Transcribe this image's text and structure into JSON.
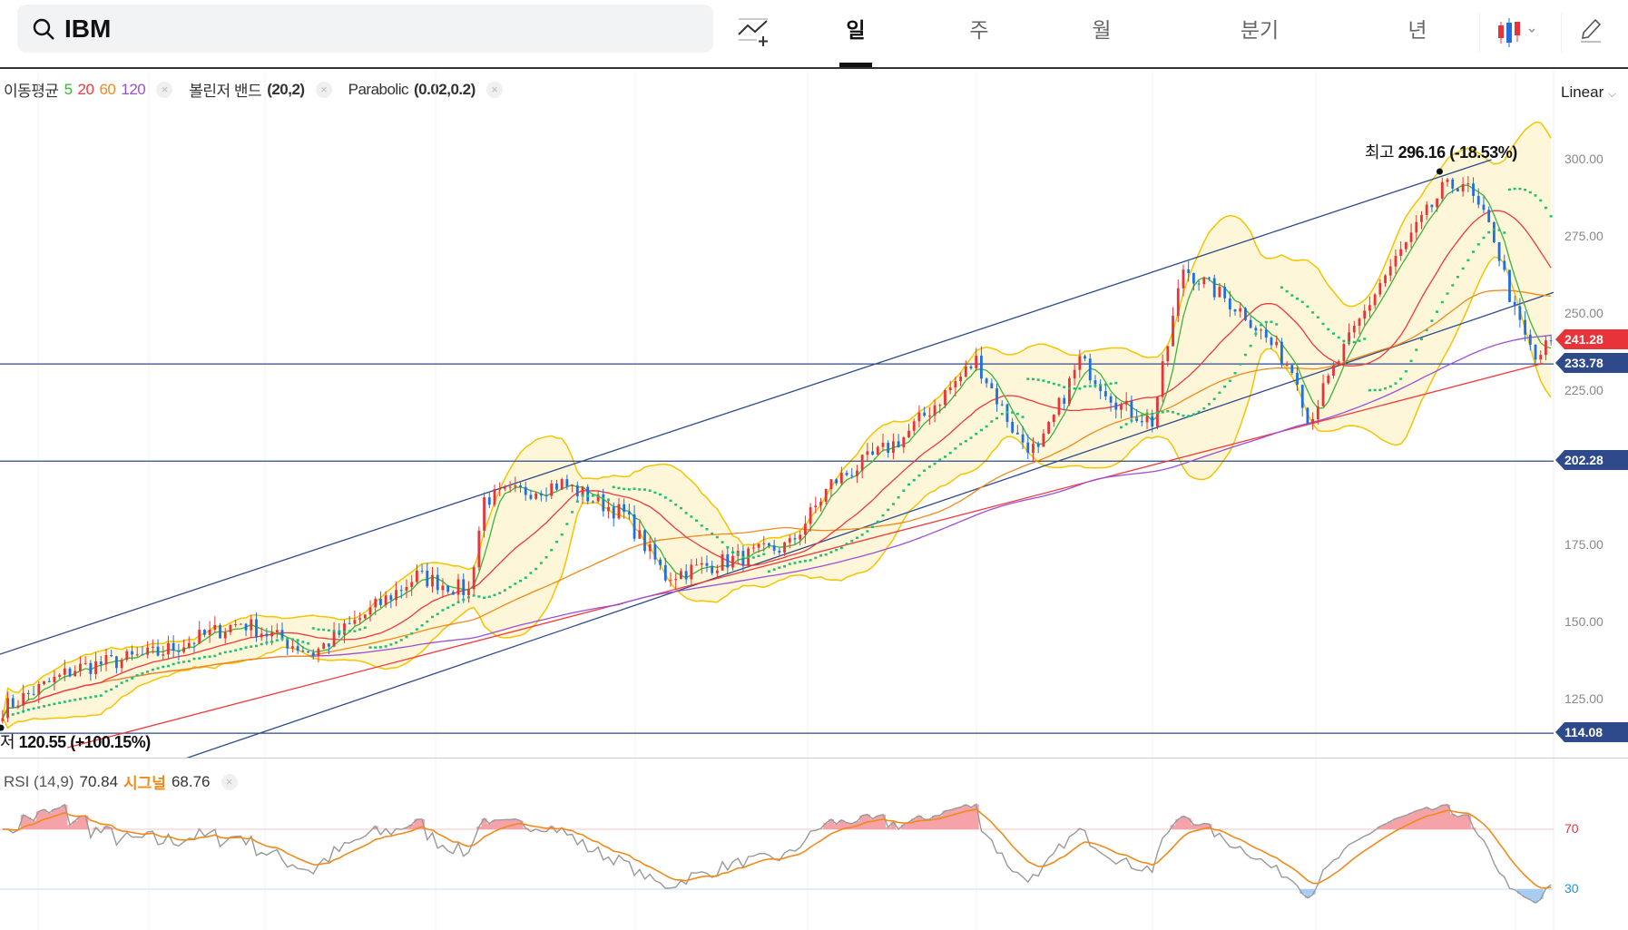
{
  "search": {
    "value": "IBM",
    "icon": "search-icon"
  },
  "toolbar": {
    "tabs": [
      "일",
      "주",
      "월",
      "분기",
      "년"
    ],
    "active_tab": "일",
    "indicator_icon": "add-indicator-icon",
    "chart_type_icon": "candlestick-icon",
    "draw_icon": "pencil-icon"
  },
  "legend": {
    "ma_label": "이동평균",
    "ma_periods": [
      "5",
      "20",
      "60",
      "120"
    ],
    "bb_label": "볼린저 밴드",
    "bb_params": "(20,2)",
    "sar_label": "Parabolic",
    "sar_params": "(0.02,0.2)",
    "close": "×"
  },
  "scale": {
    "label": "Linear"
  },
  "price_axis": {
    "ticks": [
      "300.00",
      "275.00",
      "250.00",
      "225.00",
      "175.00",
      "150.00",
      "125.00"
    ],
    "tick_values": [
      300,
      275,
      250,
      225,
      175,
      150,
      125
    ]
  },
  "tags": {
    "current": "241.28",
    "h1": "233.78",
    "h2": "202.28",
    "h3": "114.08"
  },
  "annotations": {
    "high_label": "최고",
    "high_value": "296.16 (-18.53%)",
    "low_label": "최저",
    "low_value": "120.55 (+100.15%)"
  },
  "rsi": {
    "label": "RSI (14,9)",
    "value": "70.84",
    "signal_label": "시그널",
    "signal_value": "68.76",
    "levels": [
      "70",
      "30"
    ]
  },
  "colors": {
    "up": "#e8333b",
    "down": "#1e6fe0",
    "ma5": "#3db33d",
    "ma20": "#f0393e",
    "ma60": "#f08a1c",
    "ma120": "#9b4fd6",
    "bb": "#f5c400",
    "sar": "#1fbf7a",
    "line": "#2e4a8b"
  },
  "chart_data": {
    "type": "candlestick",
    "days": 300,
    "close_keypoints": [
      [
        0,
        122
      ],
      [
        14,
        135
      ],
      [
        30,
        140
      ],
      [
        46,
        150
      ],
      [
        60,
        140
      ],
      [
        80,
        165
      ],
      [
        90,
        160
      ],
      [
        93,
        190
      ],
      [
        108,
        195
      ],
      [
        120,
        185
      ],
      [
        128,
        165
      ],
      [
        140,
        170
      ],
      [
        152,
        175
      ],
      [
        160,
        195
      ],
      [
        174,
        210
      ],
      [
        188,
        235
      ],
      [
        196,
        210
      ],
      [
        200,
        205
      ],
      [
        208,
        235
      ],
      [
        216,
        220
      ],
      [
        222,
        215
      ],
      [
        228,
        265
      ],
      [
        240,
        250
      ],
      [
        250,
        230
      ],
      [
        252,
        215
      ],
      [
        258,
        235
      ],
      [
        266,
        260
      ],
      [
        278,
        290
      ],
      [
        282,
        293
      ],
      [
        288,
        275
      ],
      [
        292,
        250
      ],
      [
        296,
        235
      ],
      [
        299,
        241.28
      ]
    ],
    "horizontal_lines": [
      233.78,
      202.28,
      114.08
    ],
    "trend_lines": [
      {
        "color": "#2e4a8b",
        "from": [
          0,
          139.7
        ],
        "to": [
          288,
          300
        ]
      },
      {
        "color": "#2e4a8b",
        "from": [
          36,
          106
        ],
        "to": [
          300,
          257
        ]
      },
      {
        "color": "#f0393e",
        "from": [
          13,
          109.4
        ],
        "to": [
          298,
          234
        ]
      }
    ],
    "high": {
      "day": 278,
      "price": 296.16
    },
    "low": {
      "day": 0,
      "price": 120.55
    },
    "ylim": [
      100,
      310
    ]
  }
}
